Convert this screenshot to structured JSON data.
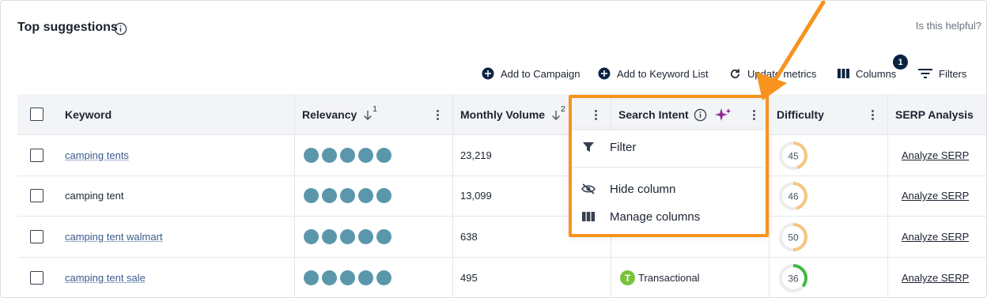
{
  "header": {
    "title": "Top suggestions",
    "helpful_text": "Is this helpful?"
  },
  "toolbar": {
    "add_campaign": "Add to Campaign",
    "add_keyword_list": "Add to Keyword List",
    "update_metrics": "Update metrics",
    "columns": "Columns",
    "columns_badge": "1",
    "filters": "Filters"
  },
  "table": {
    "columns": {
      "keyword": "Keyword",
      "relevancy": "Relevancy",
      "relevancy_sort_index": "1",
      "monthly_volume": "Monthly Volume",
      "volume_sort_index": "2",
      "search_intent": "Search Intent",
      "difficulty": "Difficulty",
      "serp": "SERP Analysis"
    },
    "rows": [
      {
        "keyword": "camping tents",
        "relevancy": 5,
        "volume": "23,219",
        "intent": "",
        "difficulty": "45",
        "difficulty_pct": 0.45,
        "difficulty_color": "#f5c583",
        "serp": "Analyze SERP"
      },
      {
        "keyword": "camping tent",
        "relevancy": 5,
        "volume": "13,099",
        "intent": "",
        "difficulty": "46",
        "difficulty_pct": 0.46,
        "difficulty_color": "#f5c583",
        "serp": "Analyze SERP"
      },
      {
        "keyword": "camping tent walmart",
        "relevancy": 5,
        "volume": "638",
        "intent": "",
        "difficulty": "50",
        "difficulty_pct": 0.5,
        "difficulty_color": "#f5c583",
        "serp": "Analyze SERP"
      },
      {
        "keyword": "camping tent sale",
        "relevancy": 5,
        "volume": "495",
        "intent": "Transactional",
        "intent_icon_letter": "T",
        "difficulty": "36",
        "difficulty_pct": 0.36,
        "difficulty_color": "#3fb93f",
        "serp": "Analyze SERP"
      }
    ]
  },
  "column_menu": {
    "filter": "Filter",
    "hide_column": "Hide column",
    "manage_columns": "Manage columns"
  },
  "colors": {
    "accent_orange": "#f7931e",
    "relevancy_dot": "#5a97ab",
    "transactional_green": "#79c23b",
    "sparkle_purple": "#8e2b8f",
    "navy": "#0b2342"
  }
}
